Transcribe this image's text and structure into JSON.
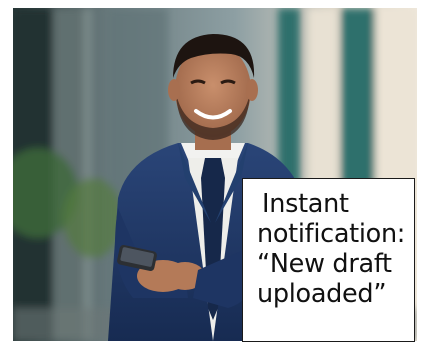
{
  "photo": {
    "subject": "photo"
  },
  "notification": {
    "line1": "Instant",
    "line2": "notification:",
    "line3": "“New draft",
    "line4": "uploaded”"
  },
  "colors": {
    "frame_border": "#1a1a1a",
    "suit": "#1f3763",
    "background_teal": "#2f6f6c"
  }
}
